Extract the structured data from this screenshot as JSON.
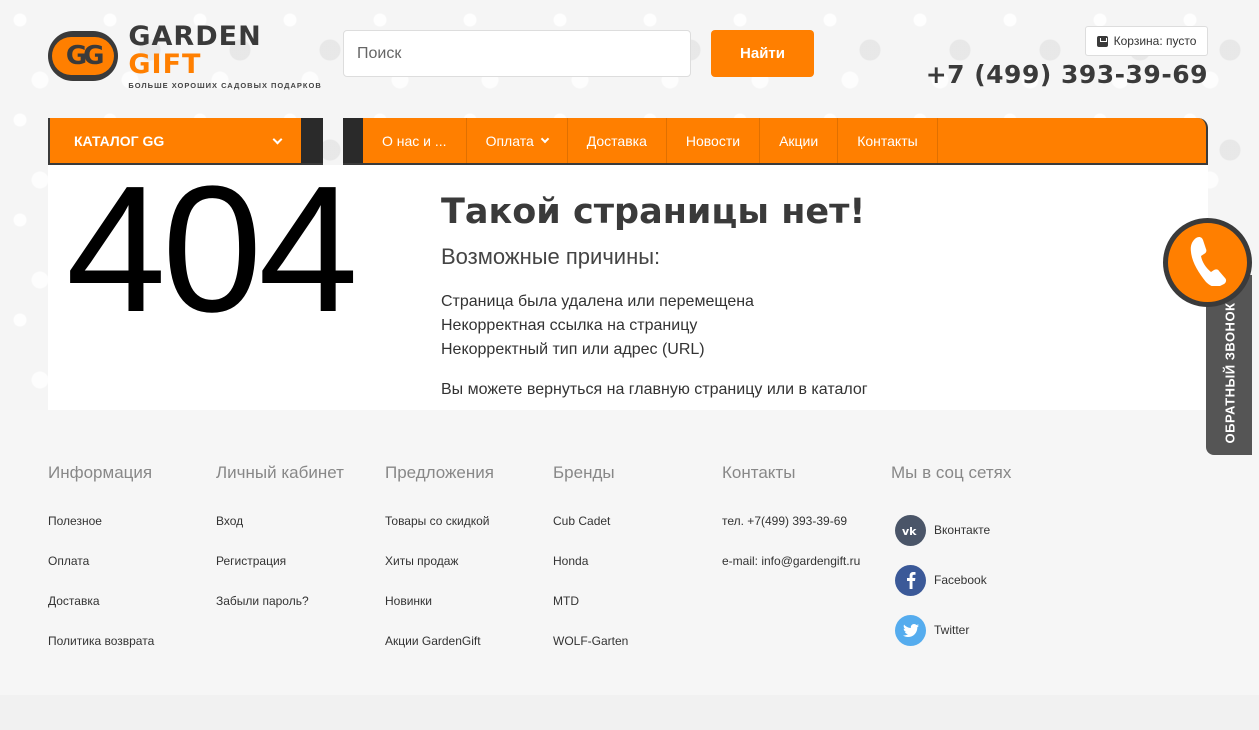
{
  "brand": {
    "logo_mark": "GG",
    "name_part1": "GARDEN",
    "name_part2": "GIFT",
    "tagline": "БОЛЬШЕ ХОРОШИХ САДОВЫХ ПОДАРКОВ",
    "accent_color": "#ff7f00",
    "dark_color": "#3a3a3a"
  },
  "search": {
    "placeholder": "Поиск",
    "button_label": "Найти"
  },
  "cart": {
    "icon": "cart-icon",
    "label": "Корзина: пусто"
  },
  "phone": "+7 (499) 393-39-69",
  "nav": {
    "catalog_label": "КАТАЛОГ GG",
    "items": [
      {
        "label": "О нас и ..."
      },
      {
        "label": "Оплата"
      },
      {
        "label": "Доставка"
      },
      {
        "label": "Новости"
      },
      {
        "label": "Акции"
      },
      {
        "label": "Контакты"
      }
    ]
  },
  "error": {
    "code": "404",
    "title": "Такой страницы нет!",
    "subtitle": "Возможные причины:",
    "reasons": [
      "Страница была удалена или перемещена",
      "Некорректная ссылка на страницу",
      "Некорректный тип или адрес (URL)"
    ],
    "back_text": "Вы можете вернуться на главную страницу или в каталог"
  },
  "callback": {
    "label": "ОБРАТНЫЙ ЗВОНОК",
    "icon": "phone-handset-icon"
  },
  "footer": {
    "columns": [
      {
        "title": "Информация",
        "links": [
          "Полезное",
          "Оплата",
          "Доставка",
          "Политика возврата"
        ]
      },
      {
        "title": "Личный кабинет",
        "links": [
          "Вход",
          "Регистрация",
          "Забыли пароль?"
        ]
      },
      {
        "title": "Предложения",
        "links": [
          "Товары со скидкой",
          "Хиты продаж",
          "Новинки",
          "Акции GardenGift"
        ]
      },
      {
        "title": "Бренды",
        "links": [
          "Cub Cadet",
          "Honda",
          "MTD",
          "WOLF-Garten"
        ]
      },
      {
        "title": "Контакты",
        "links": [
          "тел. +7(499) 393-39-69",
          "e-mail: info@gardengift.ru"
        ]
      }
    ],
    "social": {
      "title": "Мы в соц сетях",
      "items": [
        {
          "label": "Вконтакте",
          "icon": "vk-icon",
          "color": "#4a5568"
        },
        {
          "label": "Facebook",
          "icon": "facebook-icon",
          "color": "#3b5998"
        },
        {
          "label": "Twitter",
          "icon": "twitter-icon",
          "color": "#55acee"
        }
      ]
    }
  }
}
